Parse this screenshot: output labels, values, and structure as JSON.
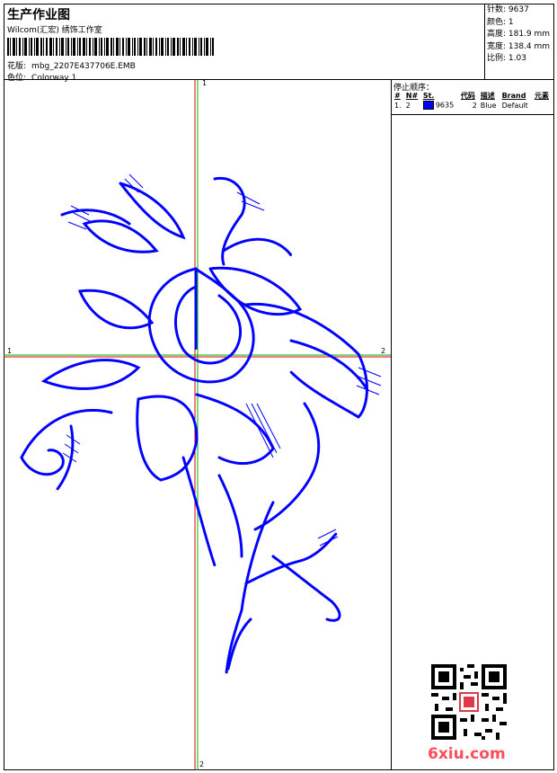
{
  "header": {
    "title": "生产作业图",
    "company": "Wilcom(汇宏) 绣饰工作室",
    "file_label": "花版:",
    "file_name": "mbg_2207E437706E.EMB",
    "colorway_label": "色位:",
    "colorway": "Colorway 1"
  },
  "stats": {
    "stitches": "针数: 9637",
    "colors": "颜色: 1",
    "height": "高度: 181.9 mm",
    "width": "宽度: 138.4 mm",
    "scale": "比例: 1.03"
  },
  "stop_sequence": {
    "title": "停止顺序：",
    "columns": [
      "#",
      "N#",
      "St.",
      "代码",
      "描述",
      "Brand",
      "元素"
    ],
    "rows": [
      {
        "index": "1.",
        "needle": "2",
        "stitches": "9635",
        "code": "2",
        "description": "Blue",
        "brand": "Default",
        "elements": ""
      }
    ]
  },
  "canvas": {
    "axis_x_start": "1",
    "axis_x_end": "2",
    "axis_y_start": "1",
    "axis_y_end": "2"
  },
  "colors": {
    "thread": "#0000ff",
    "axis_green": "#00b000",
    "axis_red": "#e00000"
  },
  "watermark": "6xiu.com"
}
